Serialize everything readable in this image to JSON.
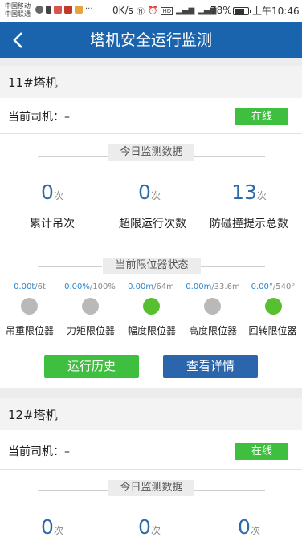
{
  "status_bar": {
    "carrier1": "中国移动",
    "carrier2": "中国联通",
    "speed": "0K/s",
    "battery": "78%",
    "battery_level": 0.78,
    "time": "上午10:46"
  },
  "header": {
    "title": "塔机安全运行监测"
  },
  "cards": [
    {
      "name": "11#塔机",
      "driver_label": "当前司机：–",
      "status": "在线",
      "today_title": "今日监测数据",
      "stats": [
        {
          "value": "0",
          "unit": "次",
          "label": "累计吊次"
        },
        {
          "value": "0",
          "unit": "次",
          "label": "超限运行次数"
        },
        {
          "value": "13",
          "unit": "次",
          "label": "防碰撞提示总数"
        }
      ],
      "limiter_title": "当前限位器状态",
      "limiters": [
        {
          "current": "0.00t",
          "max": "/6t",
          "name": "吊重限位器",
          "state": "off"
        },
        {
          "current": "0.00%",
          "max": "/100%",
          "name": "力矩限位器",
          "state": "off"
        },
        {
          "current": "0.00m",
          "max": "/64m",
          "name": "幅度限位器",
          "state": "on"
        },
        {
          "current": "0.00m",
          "max": "/33.6m",
          "name": "高度限位器",
          "state": "off"
        },
        {
          "current": "0.00°",
          "max": "/540°",
          "name": "回转限位器",
          "state": "on"
        }
      ],
      "history_button": "运行历史",
      "details_button": "查看详情"
    },
    {
      "name": "12#塔机",
      "driver_label": "当前司机：–",
      "status": "在线",
      "today_title": "今日监测数据",
      "stats": [
        {
          "value": "0",
          "unit": "次"
        },
        {
          "value": "0",
          "unit": "次"
        },
        {
          "value": "0",
          "unit": "次"
        }
      ]
    }
  ]
}
